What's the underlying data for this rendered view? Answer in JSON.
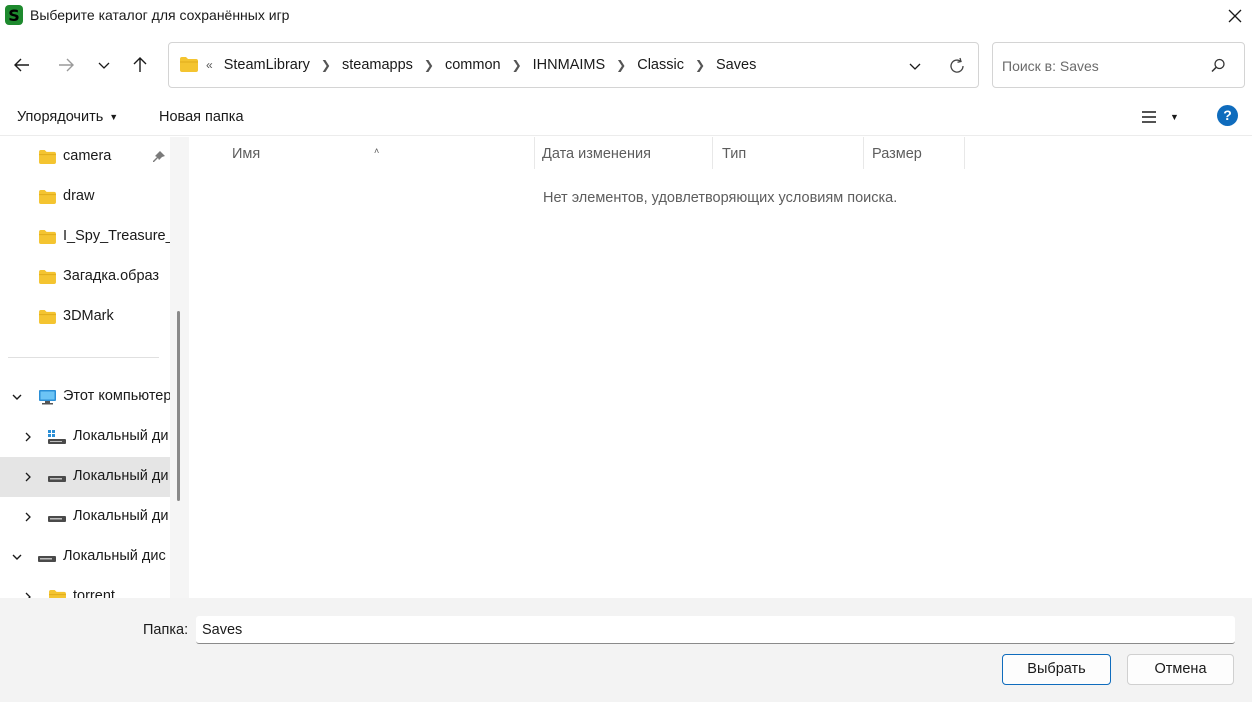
{
  "window": {
    "title": "Выберите каталог для сохранённых игр"
  },
  "address": {
    "overflow": "«",
    "crumbs": [
      "SteamLibrary",
      "steamapps",
      "common",
      "IHNMAIMS",
      "Classic",
      "Saves"
    ]
  },
  "search": {
    "placeholder": "Поиск в: Saves"
  },
  "toolbar": {
    "organize_label": "Упорядочить",
    "new_folder_label": "Новая папка"
  },
  "sidebar": {
    "quick_access": [
      "camera",
      "draw",
      "I_Spy_Treasure_H",
      "Загадка.образ",
      "3DMark"
    ],
    "this_pc": "Этот компьютер",
    "drives": [
      "Локальный ди",
      "Локальный ди",
      "Локальный ди"
    ],
    "drive_expanded": "Локальный дис",
    "subfolder": "torrent"
  },
  "columns": {
    "name": "Имя",
    "date": "Дата изменения",
    "type": "Тип",
    "size": "Размер"
  },
  "content": {
    "empty_message": "Нет элементов, удовлетворяющих условиям поиска."
  },
  "footer": {
    "folder_label": "Папка:",
    "folder_value": "Saves",
    "select_label": "Выбрать",
    "cancel_label": "Отмена"
  },
  "colors": {
    "accent": "#0f6cbd",
    "folder": "#f4c430",
    "selected": "#e5e5e5",
    "footer_bg": "#f3f3f3"
  }
}
